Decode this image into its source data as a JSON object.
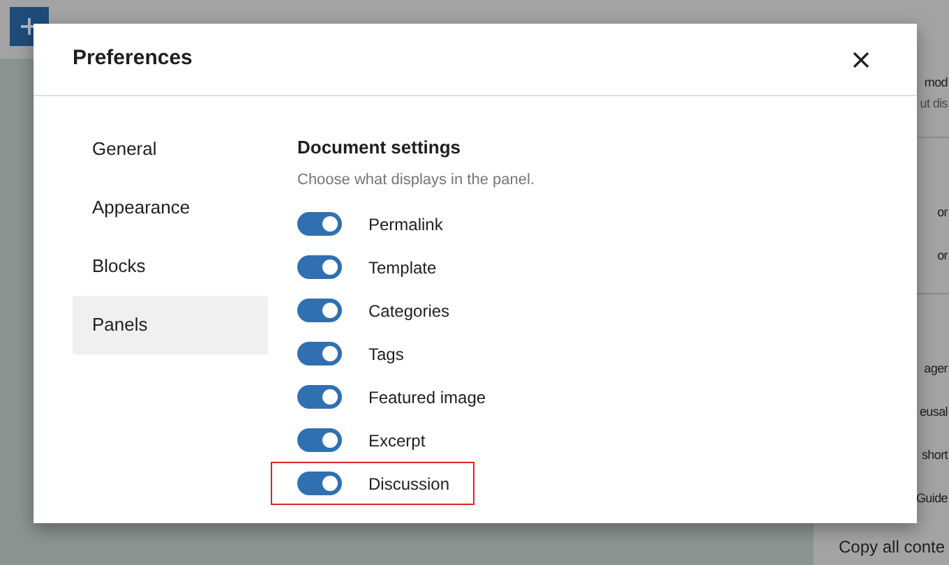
{
  "editor": {
    "menu_items": [
      {
        "label": "mod"
      },
      {
        "label": "ut dis",
        "kind": "hint"
      },
      {
        "label": "or"
      },
      {
        "label": "or"
      },
      {
        "label": "ager"
      },
      {
        "label": "eusal"
      },
      {
        "label": "short"
      },
      {
        "label": "Guide"
      },
      {
        "label": "Copy all conte"
      }
    ]
  },
  "dialog": {
    "title": "Preferences",
    "nav": [
      {
        "label": "General",
        "selected": false
      },
      {
        "label": "Appearance",
        "selected": false
      },
      {
        "label": "Blocks",
        "selected": false
      },
      {
        "label": "Panels",
        "selected": true
      }
    ],
    "section": {
      "heading": "Document settings",
      "description": "Choose what displays in the panel.",
      "options": [
        {
          "label": "Permalink",
          "on": true,
          "highlighted": false
        },
        {
          "label": "Template",
          "on": true,
          "highlighted": false
        },
        {
          "label": "Categories",
          "on": true,
          "highlighted": false
        },
        {
          "label": "Tags",
          "on": true,
          "highlighted": false
        },
        {
          "label": "Featured image",
          "on": true,
          "highlighted": false
        },
        {
          "label": "Excerpt",
          "on": true,
          "highlighted": false
        },
        {
          "label": "Discussion",
          "on": true,
          "highlighted": true
        }
      ]
    }
  }
}
